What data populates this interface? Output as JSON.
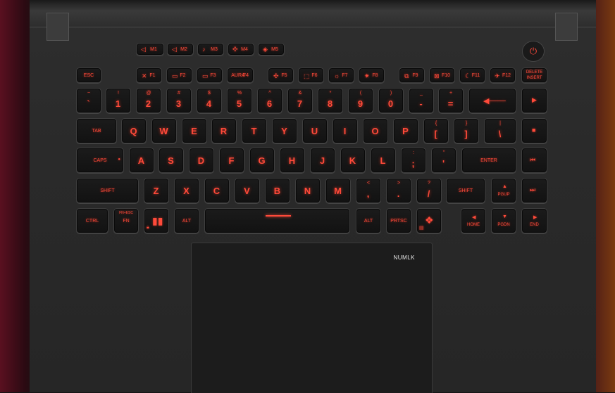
{
  "colors": {
    "backlight": "#ff4a3a",
    "deck": "#2a2a2a",
    "keycap": "#151515",
    "numlk": "#e8e8e8"
  },
  "macro_keys": [
    "M1",
    "M2",
    "M3",
    "M4",
    "M5"
  ],
  "power_icon": "power-icon",
  "function_row": {
    "esc": "ESC",
    "f": [
      "F1",
      "F2",
      "F3",
      "F4",
      "F5",
      "F6",
      "F7",
      "F8",
      "F9",
      "F10",
      "F11",
      "F12"
    ],
    "f4_alt": "AURA",
    "delete": "DELETE",
    "insert": "INSERT"
  },
  "number_row": [
    {
      "main": "`",
      "shift": "~"
    },
    {
      "main": "1",
      "shift": "!"
    },
    {
      "main": "2",
      "shift": "@"
    },
    {
      "main": "3",
      "shift": "#"
    },
    {
      "main": "4",
      "shift": "$"
    },
    {
      "main": "5",
      "shift": "%"
    },
    {
      "main": "6",
      "shift": "^"
    },
    {
      "main": "7",
      "shift": "&"
    },
    {
      "main": "8",
      "shift": "*"
    },
    {
      "main": "9",
      "shift": "("
    },
    {
      "main": "0",
      "shift": ")"
    },
    {
      "main": "-",
      "shift": "_"
    },
    {
      "main": "=",
      "shift": "+"
    }
  ],
  "qwerty_row": [
    "TAB",
    "Q",
    "W",
    "E",
    "R",
    "T",
    "Y",
    "U",
    "I",
    "O",
    "P"
  ],
  "brackets": [
    {
      "main": "[",
      "shift": "{"
    },
    {
      "main": "]",
      "shift": "}"
    },
    {
      "main": "\\",
      "shift": "|"
    }
  ],
  "home_row": [
    "CAPS",
    "A",
    "S",
    "D",
    "F",
    "G",
    "H",
    "J",
    "K",
    "L"
  ],
  "home_punct": [
    {
      "main": ";",
      "shift": ":"
    },
    {
      "main": "'",
      "shift": "\""
    }
  ],
  "enter": "ENTER",
  "bottom_row": [
    "SHIFT",
    "Z",
    "X",
    "C",
    "V",
    "B",
    "N",
    "M"
  ],
  "bottom_punct": [
    {
      "main": ",",
      "shift": "<"
    },
    {
      "main": ".",
      "shift": ">"
    },
    {
      "main": "/",
      "shift": "?"
    }
  ],
  "rshift": "SHIFT",
  "pgup": "PGUP",
  "modifiers": {
    "ctrl": "CTRL",
    "fn": "FN",
    "fn_sub": "FN+ESC",
    "alt_left": "ALT",
    "alt_right": "ALT",
    "prtsc": "PRTSC",
    "home": "HOME",
    "pgdn": "PGDN",
    "end": "END"
  },
  "touchpad": {
    "numlk": "NUMLK"
  }
}
